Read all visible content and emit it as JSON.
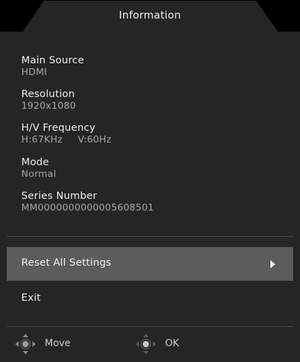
{
  "title": "Information",
  "info": {
    "main_source": {
      "label": "Main Source",
      "value": "HDMI"
    },
    "resolution": {
      "label": "Resolution",
      "value": "1920x1080"
    },
    "frequency": {
      "label": "H/V Frequency",
      "h_value": "H:67KHz",
      "v_value": "V:60Hz"
    },
    "mode": {
      "label": "Mode",
      "value": "Normal"
    },
    "series_number": {
      "label": "Series Number",
      "value": "MM0000000000005608501"
    }
  },
  "menu": {
    "reset_label": "Reset All Settings",
    "exit_label": "Exit"
  },
  "hints": {
    "move_label": "Move",
    "ok_label": "OK"
  },
  "colors": {
    "panel": "#252525",
    "title_tab": "#000000",
    "selected_row": "#5c5c5c",
    "label_text": "#f0f0f0",
    "value_text": "#a8a8a8"
  },
  "icons": {
    "selected_arrow": "right-arrow-icon",
    "move_hint": "four-way-dpad-icon",
    "ok_hint": "dpad-press-icon"
  }
}
